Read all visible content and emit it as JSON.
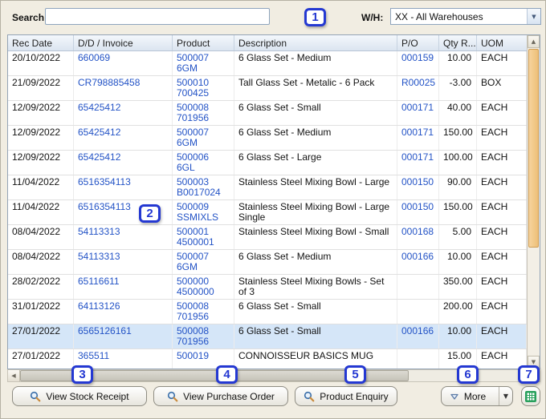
{
  "toolbar": {
    "search_label": "Search:",
    "search_value": "",
    "wh_label": "W/H:",
    "wh_value": "XX - All Warehouses"
  },
  "table": {
    "columns": [
      "Rec Date",
      "D/D / Invoice",
      "Product",
      "Description",
      "P/O",
      "Qty R...",
      "UOM"
    ],
    "rows": [
      {
        "rec_date": "20/10/2022",
        "invoice": "660069",
        "product": [
          "500007",
          "6GM"
        ],
        "description": "6 Glass Set - Medium",
        "po": "000159",
        "qty": "10.00",
        "uom": "EACH",
        "selected": false
      },
      {
        "rec_date": "21/09/2022",
        "invoice": "CR798885458",
        "product": [
          "500010",
          "700425"
        ],
        "description": "Tall Glass Set - Metalic - 6 Pack",
        "po": "R00025",
        "qty": "-3.00",
        "uom": "BOX",
        "selected": false
      },
      {
        "rec_date": "12/09/2022",
        "invoice": "65425412",
        "product": [
          "500008",
          "701956"
        ],
        "description": "6 Glass Set - Small",
        "po": "000171",
        "qty": "40.00",
        "uom": "EACH",
        "selected": false
      },
      {
        "rec_date": "12/09/2022",
        "invoice": "65425412",
        "product": [
          "500007",
          "6GM"
        ],
        "description": "6 Glass Set - Medium",
        "po": "000171",
        "qty": "150.00",
        "uom": "EACH",
        "selected": false
      },
      {
        "rec_date": "12/09/2022",
        "invoice": "65425412",
        "product": [
          "500006",
          "6GL"
        ],
        "description": "6 Glass Set - Large",
        "po": "000171",
        "qty": "100.00",
        "uom": "EACH",
        "selected": false
      },
      {
        "rec_date": "11/04/2022",
        "invoice": "6516354113",
        "product": [
          "500003",
          "B0017024"
        ],
        "description": "Stainless Steel Mixing Bowl - Large",
        "po": "000150",
        "qty": "90.00",
        "uom": "EACH",
        "selected": false
      },
      {
        "rec_date": "11/04/2022",
        "invoice": "6516354113",
        "product": [
          "500009",
          "SSMIXLS"
        ],
        "description": "Stainless Steel Mixing Bowl - Large Single",
        "po": "000150",
        "qty": "150.00",
        "uom": "EACH",
        "selected": false
      },
      {
        "rec_date": "08/04/2022",
        "invoice": "54113313",
        "product": [
          "500001",
          "4500001"
        ],
        "description": "Stainless Steel Mixing Bowl - Small",
        "po": "000168",
        "qty": "5.00",
        "uom": "EACH",
        "selected": false
      },
      {
        "rec_date": "08/04/2022",
        "invoice": "54113313",
        "product": [
          "500007",
          "6GM"
        ],
        "description": "6 Glass Set - Medium",
        "po": "000166",
        "qty": "10.00",
        "uom": "EACH",
        "selected": false
      },
      {
        "rec_date": "28/02/2022",
        "invoice": "65116611",
        "product": [
          "500000",
          "4500000"
        ],
        "description": "Stainless Steel Mixing Bowls - Set of 3",
        "po": "",
        "qty": "350.00",
        "uom": "EACH",
        "selected": false
      },
      {
        "rec_date": "31/01/2022",
        "invoice": "64113126",
        "product": [
          "500008",
          "701956"
        ],
        "description": "6 Glass Set - Small",
        "po": "",
        "qty": "200.00",
        "uom": "EACH",
        "selected": false
      },
      {
        "rec_date": "27/01/2022",
        "invoice": "6565126161",
        "product": [
          "500008",
          "701956"
        ],
        "description": "6 Glass Set - Small",
        "po": "000166",
        "qty": "10.00",
        "uom": "EACH",
        "selected": true
      },
      {
        "rec_date": "27/01/2022",
        "invoice": "365511",
        "product": [
          "500019"
        ],
        "description": "CONNOISSEUR BASICS MUG",
        "po": "",
        "qty": "15.00",
        "uom": "EACH",
        "selected": false
      }
    ]
  },
  "buttons": {
    "view_stock_receipt": "View Stock Receipt",
    "view_purchase_order": "View Purchase Order",
    "product_enquiry": "Product Enquiry",
    "more": "More"
  },
  "badges": [
    "1",
    "2",
    "3",
    "4",
    "5",
    "6",
    "7"
  ],
  "colors": {
    "link": "#2353c6",
    "selected_row": "#d5e6f8",
    "badge": "#2438d2",
    "excel_green": "#28a05c"
  }
}
